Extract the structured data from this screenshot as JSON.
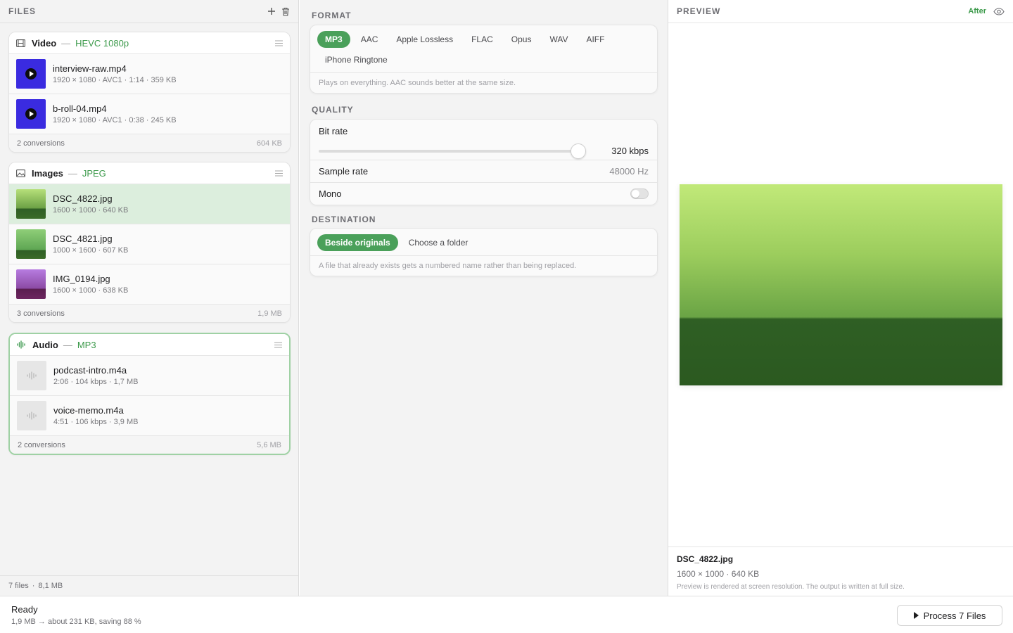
{
  "sidebar": {
    "title": "FILES",
    "footer_count": "7 files",
    "footer_sep": "·",
    "footer_size": "8,1 MB",
    "groups": [
      {
        "name": "Video",
        "format": "HEVC 1080p",
        "files": [
          {
            "name": "interview-raw.mp4",
            "meta": "1920 × 1080 · AVC1 · 1:14 · 359 KB"
          },
          {
            "name": "b-roll-04.mp4",
            "meta": "1920 × 1080 · AVC1 · 0:38 · 245 KB"
          }
        ],
        "conversions": "2 conversions",
        "size": "604 KB"
      },
      {
        "name": "Images",
        "format": "JPEG",
        "files": [
          {
            "name": "DSC_4822.jpg",
            "meta": "1600 × 1000 · 640 KB"
          },
          {
            "name": "DSC_4821.jpg",
            "meta": "1000 × 1600 · 607 KB"
          },
          {
            "name": "IMG_0194.jpg",
            "meta": "1600 × 1000 · 638 KB"
          }
        ],
        "conversions": "3 conversions",
        "size": "1,9 MB"
      },
      {
        "name": "Audio",
        "format": "MP3",
        "files": [
          {
            "name": "podcast-intro.m4a",
            "meta": "2:06 · 104 kbps · 1,7 MB"
          },
          {
            "name": "voice-memo.m4a",
            "meta": "4:51 · 106 kbps · 3,9 MB"
          }
        ],
        "conversions": "2 conversions",
        "size": "5,6 MB"
      }
    ]
  },
  "format": {
    "label": "FORMAT",
    "options": [
      "MP3",
      "AAC",
      "Apple Lossless",
      "FLAC",
      "Opus",
      "WAV",
      "AIFF",
      "iPhone Ringtone"
    ],
    "selected": "MP3",
    "hint": "Plays on everything. AAC sounds better at the same size."
  },
  "quality": {
    "label": "QUALITY",
    "bitrate_label": "Bit rate",
    "bitrate_value": "320 kbps",
    "bitrate_level": 1.0,
    "samplerate_label": "Sample rate",
    "samplerate_value": "48000 Hz",
    "mono_label": "Mono",
    "mono_on": false
  },
  "destination": {
    "label": "DESTINATION",
    "options": [
      "Beside originals",
      "Choose a folder"
    ],
    "selected": "Beside originals",
    "hint": "A file that already exists gets a numbered name rather than being replaced."
  },
  "preview": {
    "title": "PREVIEW",
    "mode": "After",
    "file_name": "DSC_4822.jpg",
    "file_meta": "1600 × 1000 · 640 KB",
    "hint": "Preview is rendered at screen resolution. The output is written at full size."
  },
  "status": {
    "title": "Ready",
    "detail": "1,9 MB → about 231 KB, saving 88 %"
  },
  "process_button": "Process 7 Files",
  "colors": {
    "accent": "#4aa05a",
    "accent_text": "#3c9a4b",
    "selected_row": "#dceedd"
  }
}
